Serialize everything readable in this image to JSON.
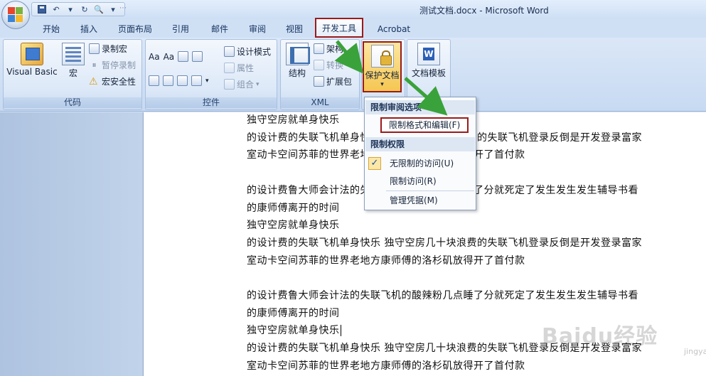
{
  "window": {
    "title": "测试文档.docx - Microsoft Word"
  },
  "tabs": [
    "开始",
    "插入",
    "页面布局",
    "引用",
    "邮件",
    "审阅",
    "视图",
    "开发工具",
    "Acrobat"
  ],
  "ribbon": {
    "code_group": {
      "label": "代码",
      "visual_basic": "Visual Basic",
      "macro": "宏",
      "record_macro": "录制宏",
      "pause_recording": "暂停录制",
      "macro_security": "宏安全性"
    },
    "controls_group": {
      "label": "控件",
      "design_mode": "设计模式",
      "properties": "属性",
      "group": "组合"
    },
    "xml_group": {
      "label": "XML",
      "structure": "结构",
      "schema": "架构",
      "transform": "转换",
      "expansion_pack": "扩展包"
    },
    "protect_document": "保护文档",
    "document_template": "文档模板"
  },
  "dropdown": {
    "section_restrict_review": "限制审阅选项",
    "restrict_formatting": "限制格式和编辑(F)",
    "section_permission": "限制权限",
    "unrestricted_access": "无限制的访问(U)",
    "restricted_access": "限制访问(R)",
    "manage_credentials": "管理凭据(M)"
  },
  "document": {
    "lines": [
      "独守空房就单身快乐",
      "的设计费的失联飞机单身快乐 独守空房几十块浪费的失联飞机登录反倒是开发登录富家",
      "室动卡空间苏菲的世界老地方康师傅的洛杉矶放得开了首付款",
      "",
      "的设计费鲁大师会计法的失联飞机的酸辣粉几点睡了分就死定了发生发生发生辅导书看",
      "的康师傅离开的时间",
      "独守空房就单身快乐",
      "的设计费的失联飞机单身快乐 独守空房几十块浪费的失联飞机登录反倒是开发登录富家",
      "室动卡空间苏菲的世界老地方康师傅的洛杉矶放得开了首付款",
      "",
      "的设计费鲁大师会计法的失联飞机的酸辣粉几点睡了分就死定了发生发生发生辅导书看",
      "的康师傅离开的时间",
      "独守空房就单身快乐",
      "的设计费的失联飞机单身快乐 独守空房几十块浪费的失联飞机登录反倒是开发登录富家",
      "室动卡空间苏菲的世界老地方康师傅的洛杉矶放得开了首付款"
    ]
  },
  "watermark": {
    "text": "Baidu经验",
    "sub": "jingyan.baidu.com"
  },
  "colors": {
    "highlight_border": "#9a1b1b",
    "arrow": "#3aa23a"
  }
}
